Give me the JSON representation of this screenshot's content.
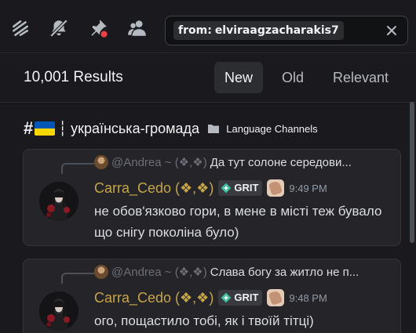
{
  "toolbar": {
    "icons": [
      "threads-icon",
      "mute-bell-icon",
      "pin-icon",
      "members-icon"
    ],
    "search": {
      "filter_key": "from:",
      "filter_value": "elviraagzacharakis7"
    }
  },
  "results": {
    "count": "10,001 Results",
    "sort_tabs": [
      {
        "label": "New",
        "active": true
      },
      {
        "label": "Old",
        "active": false
      },
      {
        "label": "Relevant",
        "active": false
      }
    ]
  },
  "channel": {
    "hash": "#",
    "name": "┆ українська-громада",
    "category": "Language Channels"
  },
  "messages": [
    {
      "reply": {
        "author": "@Andrea ~ (❖,❖)",
        "text": "Да тут солоне середови..."
      },
      "author": "Carra_Cedo (❖,❖)",
      "tag": "GRIT",
      "time": "9:49 PM",
      "text": "не обов'язково гори, в мене в місті теж бувало що снігу поколіна було)"
    },
    {
      "reply": {
        "author": "@Andrea ~ (❖,❖)",
        "text": "Слава богу за житло не п..."
      },
      "author": "Carra_Cedo (❖,❖)",
      "tag": "GRIT",
      "time": "9:48 PM",
      "text": "ого, пощастило тобі, як і твоїй тітці)"
    }
  ],
  "colors": {
    "background": "#1a1a1e",
    "card": "#242429",
    "author": "#c6a648",
    "pin_dot": "#f23f43",
    "flag_blue": "#0057b7",
    "flag_yellow": "#ffd700"
  }
}
